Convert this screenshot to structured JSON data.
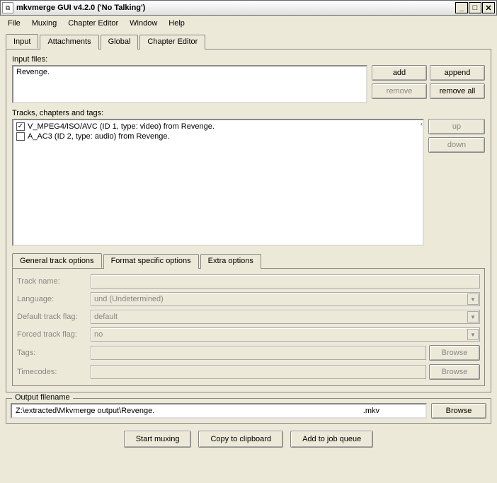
{
  "window": {
    "title": "mkvmerge GUI v4.2.0 ('No Talking')"
  },
  "menubar": [
    "File",
    "Muxing",
    "Chapter Editor",
    "Window",
    "Help"
  ],
  "main_tabs": {
    "items": [
      "Input",
      "Attachments",
      "Global",
      "Chapter Editor"
    ],
    "active": 0
  },
  "input_files": {
    "label": "Input files:",
    "items": [
      "Revenge."
    ],
    "buttons": {
      "add": "add",
      "append": "append",
      "remove": "remove",
      "remove_all": "remove all"
    }
  },
  "tracks": {
    "label": "Tracks, chapters and tags:",
    "items": [
      {
        "checked": true,
        "text": "V_MPEG4/ISO/AVC (ID 1, type: video) from Revenge."
      },
      {
        "checked": false,
        "text": "A_AC3 (ID 2, type: audio) from Revenge."
      }
    ],
    "buttons": {
      "up": "up",
      "down": "down"
    }
  },
  "options_tabs": {
    "items": [
      "General track options",
      "Format specific options",
      "Extra options"
    ],
    "active": 0
  },
  "track_options": {
    "track_name": {
      "label": "Track name:",
      "value": ""
    },
    "language": {
      "label": "Language:",
      "value": "und (Undetermined)"
    },
    "default_flag": {
      "label": "Default track flag:",
      "value": "default"
    },
    "forced_flag": {
      "label": "Forced track flag:",
      "value": "no"
    },
    "tags": {
      "label": "Tags:",
      "value": "",
      "browse": "Browse"
    },
    "timecodes": {
      "label": "Timecodes:",
      "value": "",
      "browse": "Browse"
    }
  },
  "output": {
    "groupbox_title": "Output filename",
    "path": "Z:\\extracted\\Mkvmerge output\\Revenge.",
    "ext": ".mkv",
    "browse": "Browse"
  },
  "bottom_buttons": {
    "start": "Start muxing",
    "copy": "Copy to clipboard",
    "queue": "Add to job queue"
  }
}
